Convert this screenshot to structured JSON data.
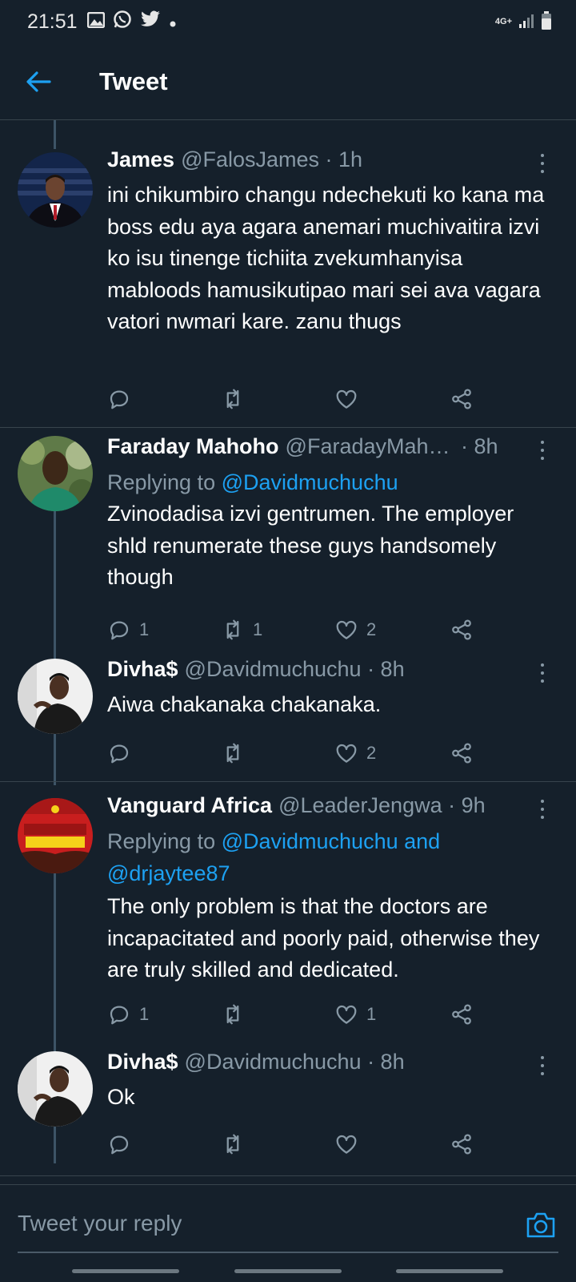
{
  "status_bar": {
    "time": "21:51",
    "icons": [
      "gallery-icon",
      "whatsapp-icon",
      "twitter-icon",
      "dot-icon"
    ],
    "network": "4G+"
  },
  "header": {
    "title": "Tweet",
    "back_icon": "back-arrow-icon"
  },
  "tweets": [
    {
      "name": "James",
      "handle": "@FalosJames",
      "time": " · 1h",
      "reply_prefix": "",
      "reply_to": "",
      "text": "ini chikumbiro changu ndechekuti ko kana ma boss edu aya agara anemari muchivaitira izvi ko isu tinenge tichiita zvekumhanyisa mabloods hamusikutipao mari sei ava vagara vatori nwmari kare. zanu thugs",
      "replies": "",
      "retweets": "",
      "likes": ""
    },
    {
      "name": "Faraday Mahoho",
      "handle": "@FaradayMah…",
      "time": " · 8h",
      "reply_prefix": "Replying to ",
      "reply_to": "@Davidmuchuchu",
      "text": "Zvinodadisa izvi gentrumen. The employer shld renumerate these guys handsomely though",
      "replies": "1",
      "retweets": "1",
      "likes": "2"
    },
    {
      "name": "Divha$",
      "handle": "@Davidmuchuchu",
      "time": " · 8h",
      "reply_prefix": "",
      "reply_to": "",
      "text": "Aiwa  chakanaka chakanaka.",
      "replies": "",
      "retweets": "",
      "likes": "2"
    },
    {
      "name": "Vanguard Africa",
      "handle": "@LeaderJengwa",
      "time": " · 9h",
      "reply_prefix": "Replying to ",
      "reply_to": "@Davidmuchuchu and @drjaytee87",
      "text": "The only problem is that the doctors are incapacitated and poorly paid, otherwise they are  truly skilled and dedicated.",
      "replies": "1",
      "retweets": "",
      "likes": "1"
    },
    {
      "name": "Divha$",
      "handle": "@Davidmuchuchu",
      "time": " · 8h",
      "reply_prefix": "",
      "reply_to": "",
      "text": "Ok",
      "replies": "",
      "retweets": "",
      "likes": ""
    }
  ],
  "reply_bar": {
    "placeholder": "Tweet your reply",
    "camera_icon": "camera-icon"
  },
  "colors": {
    "background": "#15202b",
    "divider": "#38444d",
    "secondary_text": "#8899a6",
    "accent": "#1da1f2"
  }
}
